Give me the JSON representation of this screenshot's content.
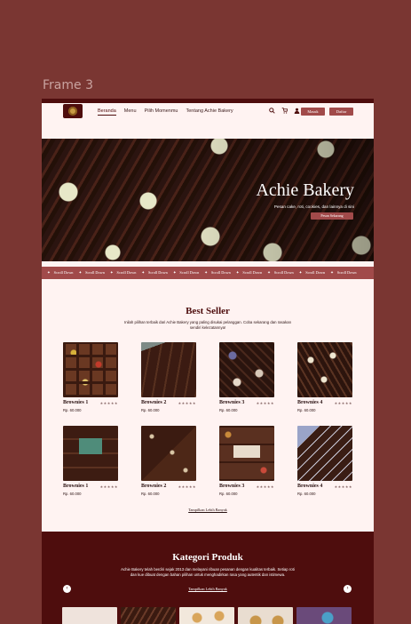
{
  "frame_label": "Frame 3",
  "nav": {
    "items": [
      "Beranda",
      "Menu",
      "Pilih Momenmu",
      "Tentang Achie Bakery"
    ],
    "masuk": "Masuk",
    "daftar": "Daftar",
    "icons": [
      "search-icon",
      "cart-icon",
      "user-icon"
    ]
  },
  "hero": {
    "title": "Achie Bakery",
    "subtitle": "Pesan cake, roti, cookies, dan lainnya di sini",
    "button": "Pesan Sekarang"
  },
  "marquee": {
    "label": "Scroll Down",
    "star": "✦"
  },
  "best_seller": {
    "title": "Best Seller",
    "desc_line1": "Inilah pilihan terbaik dari Achie Bakery yang paling disukai pelanggan. Coba sekarang dan rasakan",
    "desc_line2": "sendiri kelezatannya!",
    "stars": "★★★★★",
    "products": [
      {
        "name": "Brownies 1",
        "price": "Rp. 60.000"
      },
      {
        "name": "Brownies 2",
        "price": "Rp. 60.000"
      },
      {
        "name": "Brownies 3",
        "price": "Rp. 60.000"
      },
      {
        "name": "Brownies 4",
        "price": "Rp. 60.000"
      },
      {
        "name": "Brownies 1",
        "price": "Rp. 60.000"
      },
      {
        "name": "Brownies 2",
        "price": "Rp. 60.000"
      },
      {
        "name": "Brownies 3",
        "price": "Rp. 60.000"
      },
      {
        "name": "Brownies 4",
        "price": "Rp. 60.000"
      }
    ],
    "more": "Tampilkan Lebih Banyak"
  },
  "kategori": {
    "title": "Kategori Produk",
    "desc_line1": "Achie Bakery telah berdiri sejak 2013 dan melayani ribuan pesanan dengan kualitas terbaik. Setiap roti",
    "desc_line2": "dan kue dibuat dengan bahan pilihan untuk menghadirkan rasa yang autentik dan istimewa.",
    "more": "Tampilkan Lebih Banyak",
    "prev": "‹",
    "next": "›"
  },
  "colors": {
    "brand_dark": "#4e0d0d",
    "brand_accent": "#a14a4a",
    "page_bg": "#fff3f2",
    "canvas_bg": "#7a3632"
  }
}
